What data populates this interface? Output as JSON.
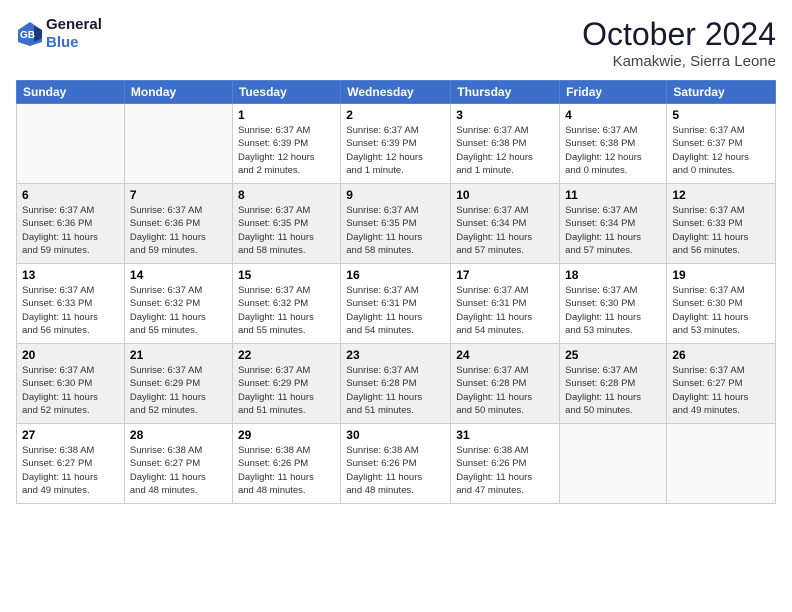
{
  "header": {
    "logo_line1": "General",
    "logo_line2": "Blue",
    "month": "October 2024",
    "location": "Kamakwie, Sierra Leone"
  },
  "weekdays": [
    "Sunday",
    "Monday",
    "Tuesday",
    "Wednesday",
    "Thursday",
    "Friday",
    "Saturday"
  ],
  "weeks": [
    [
      {
        "day": "",
        "info": ""
      },
      {
        "day": "",
        "info": ""
      },
      {
        "day": "1",
        "info": "Sunrise: 6:37 AM\nSunset: 6:39 PM\nDaylight: 12 hours\nand 2 minutes."
      },
      {
        "day": "2",
        "info": "Sunrise: 6:37 AM\nSunset: 6:39 PM\nDaylight: 12 hours\nand 1 minute."
      },
      {
        "day": "3",
        "info": "Sunrise: 6:37 AM\nSunset: 6:38 PM\nDaylight: 12 hours\nand 1 minute."
      },
      {
        "day": "4",
        "info": "Sunrise: 6:37 AM\nSunset: 6:38 PM\nDaylight: 12 hours\nand 0 minutes."
      },
      {
        "day": "5",
        "info": "Sunrise: 6:37 AM\nSunset: 6:37 PM\nDaylight: 12 hours\nand 0 minutes."
      }
    ],
    [
      {
        "day": "6",
        "info": "Sunrise: 6:37 AM\nSunset: 6:36 PM\nDaylight: 11 hours\nand 59 minutes."
      },
      {
        "day": "7",
        "info": "Sunrise: 6:37 AM\nSunset: 6:36 PM\nDaylight: 11 hours\nand 59 minutes."
      },
      {
        "day": "8",
        "info": "Sunrise: 6:37 AM\nSunset: 6:35 PM\nDaylight: 11 hours\nand 58 minutes."
      },
      {
        "day": "9",
        "info": "Sunrise: 6:37 AM\nSunset: 6:35 PM\nDaylight: 11 hours\nand 58 minutes."
      },
      {
        "day": "10",
        "info": "Sunrise: 6:37 AM\nSunset: 6:34 PM\nDaylight: 11 hours\nand 57 minutes."
      },
      {
        "day": "11",
        "info": "Sunrise: 6:37 AM\nSunset: 6:34 PM\nDaylight: 11 hours\nand 57 minutes."
      },
      {
        "day": "12",
        "info": "Sunrise: 6:37 AM\nSunset: 6:33 PM\nDaylight: 11 hours\nand 56 minutes."
      }
    ],
    [
      {
        "day": "13",
        "info": "Sunrise: 6:37 AM\nSunset: 6:33 PM\nDaylight: 11 hours\nand 56 minutes."
      },
      {
        "day": "14",
        "info": "Sunrise: 6:37 AM\nSunset: 6:32 PM\nDaylight: 11 hours\nand 55 minutes."
      },
      {
        "day": "15",
        "info": "Sunrise: 6:37 AM\nSunset: 6:32 PM\nDaylight: 11 hours\nand 55 minutes."
      },
      {
        "day": "16",
        "info": "Sunrise: 6:37 AM\nSunset: 6:31 PM\nDaylight: 11 hours\nand 54 minutes."
      },
      {
        "day": "17",
        "info": "Sunrise: 6:37 AM\nSunset: 6:31 PM\nDaylight: 11 hours\nand 54 minutes."
      },
      {
        "day": "18",
        "info": "Sunrise: 6:37 AM\nSunset: 6:30 PM\nDaylight: 11 hours\nand 53 minutes."
      },
      {
        "day": "19",
        "info": "Sunrise: 6:37 AM\nSunset: 6:30 PM\nDaylight: 11 hours\nand 53 minutes."
      }
    ],
    [
      {
        "day": "20",
        "info": "Sunrise: 6:37 AM\nSunset: 6:30 PM\nDaylight: 11 hours\nand 52 minutes."
      },
      {
        "day": "21",
        "info": "Sunrise: 6:37 AM\nSunset: 6:29 PM\nDaylight: 11 hours\nand 52 minutes."
      },
      {
        "day": "22",
        "info": "Sunrise: 6:37 AM\nSunset: 6:29 PM\nDaylight: 11 hours\nand 51 minutes."
      },
      {
        "day": "23",
        "info": "Sunrise: 6:37 AM\nSunset: 6:28 PM\nDaylight: 11 hours\nand 51 minutes."
      },
      {
        "day": "24",
        "info": "Sunrise: 6:37 AM\nSunset: 6:28 PM\nDaylight: 11 hours\nand 50 minutes."
      },
      {
        "day": "25",
        "info": "Sunrise: 6:37 AM\nSunset: 6:28 PM\nDaylight: 11 hours\nand 50 minutes."
      },
      {
        "day": "26",
        "info": "Sunrise: 6:37 AM\nSunset: 6:27 PM\nDaylight: 11 hours\nand 49 minutes."
      }
    ],
    [
      {
        "day": "27",
        "info": "Sunrise: 6:38 AM\nSunset: 6:27 PM\nDaylight: 11 hours\nand 49 minutes."
      },
      {
        "day": "28",
        "info": "Sunrise: 6:38 AM\nSunset: 6:27 PM\nDaylight: 11 hours\nand 48 minutes."
      },
      {
        "day": "29",
        "info": "Sunrise: 6:38 AM\nSunset: 6:26 PM\nDaylight: 11 hours\nand 48 minutes."
      },
      {
        "day": "30",
        "info": "Sunrise: 6:38 AM\nSunset: 6:26 PM\nDaylight: 11 hours\nand 48 minutes."
      },
      {
        "day": "31",
        "info": "Sunrise: 6:38 AM\nSunset: 6:26 PM\nDaylight: 11 hours\nand 47 minutes."
      },
      {
        "day": "",
        "info": ""
      },
      {
        "day": "",
        "info": ""
      }
    ]
  ]
}
